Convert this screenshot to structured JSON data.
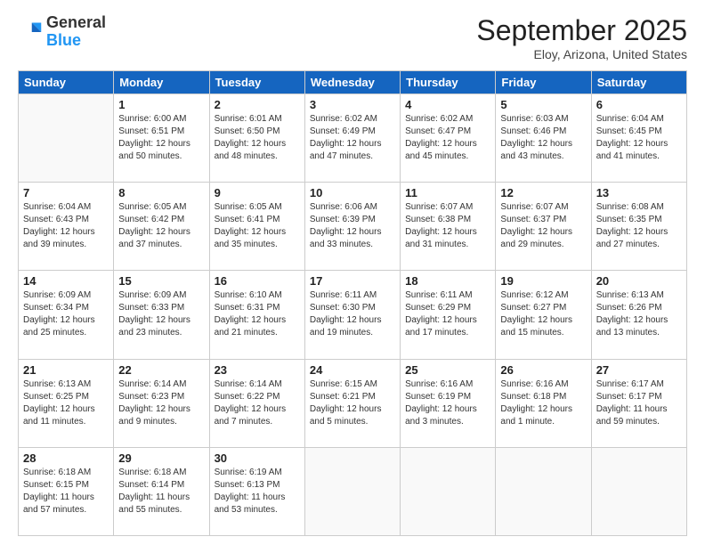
{
  "logo": {
    "general": "General",
    "blue": "Blue"
  },
  "header": {
    "month": "September 2025",
    "location": "Eloy, Arizona, United States"
  },
  "weekdays": [
    "Sunday",
    "Monday",
    "Tuesday",
    "Wednesday",
    "Thursday",
    "Friday",
    "Saturday"
  ],
  "weeks": [
    [
      {
        "day": "",
        "info": ""
      },
      {
        "day": "1",
        "info": "Sunrise: 6:00 AM\nSunset: 6:51 PM\nDaylight: 12 hours\nand 50 minutes."
      },
      {
        "day": "2",
        "info": "Sunrise: 6:01 AM\nSunset: 6:50 PM\nDaylight: 12 hours\nand 48 minutes."
      },
      {
        "day": "3",
        "info": "Sunrise: 6:02 AM\nSunset: 6:49 PM\nDaylight: 12 hours\nand 47 minutes."
      },
      {
        "day": "4",
        "info": "Sunrise: 6:02 AM\nSunset: 6:47 PM\nDaylight: 12 hours\nand 45 minutes."
      },
      {
        "day": "5",
        "info": "Sunrise: 6:03 AM\nSunset: 6:46 PM\nDaylight: 12 hours\nand 43 minutes."
      },
      {
        "day": "6",
        "info": "Sunrise: 6:04 AM\nSunset: 6:45 PM\nDaylight: 12 hours\nand 41 minutes."
      }
    ],
    [
      {
        "day": "7",
        "info": "Sunrise: 6:04 AM\nSunset: 6:43 PM\nDaylight: 12 hours\nand 39 minutes."
      },
      {
        "day": "8",
        "info": "Sunrise: 6:05 AM\nSunset: 6:42 PM\nDaylight: 12 hours\nand 37 minutes."
      },
      {
        "day": "9",
        "info": "Sunrise: 6:05 AM\nSunset: 6:41 PM\nDaylight: 12 hours\nand 35 minutes."
      },
      {
        "day": "10",
        "info": "Sunrise: 6:06 AM\nSunset: 6:39 PM\nDaylight: 12 hours\nand 33 minutes."
      },
      {
        "day": "11",
        "info": "Sunrise: 6:07 AM\nSunset: 6:38 PM\nDaylight: 12 hours\nand 31 minutes."
      },
      {
        "day": "12",
        "info": "Sunrise: 6:07 AM\nSunset: 6:37 PM\nDaylight: 12 hours\nand 29 minutes."
      },
      {
        "day": "13",
        "info": "Sunrise: 6:08 AM\nSunset: 6:35 PM\nDaylight: 12 hours\nand 27 minutes."
      }
    ],
    [
      {
        "day": "14",
        "info": "Sunrise: 6:09 AM\nSunset: 6:34 PM\nDaylight: 12 hours\nand 25 minutes."
      },
      {
        "day": "15",
        "info": "Sunrise: 6:09 AM\nSunset: 6:33 PM\nDaylight: 12 hours\nand 23 minutes."
      },
      {
        "day": "16",
        "info": "Sunrise: 6:10 AM\nSunset: 6:31 PM\nDaylight: 12 hours\nand 21 minutes."
      },
      {
        "day": "17",
        "info": "Sunrise: 6:11 AM\nSunset: 6:30 PM\nDaylight: 12 hours\nand 19 minutes."
      },
      {
        "day": "18",
        "info": "Sunrise: 6:11 AM\nSunset: 6:29 PM\nDaylight: 12 hours\nand 17 minutes."
      },
      {
        "day": "19",
        "info": "Sunrise: 6:12 AM\nSunset: 6:27 PM\nDaylight: 12 hours\nand 15 minutes."
      },
      {
        "day": "20",
        "info": "Sunrise: 6:13 AM\nSunset: 6:26 PM\nDaylight: 12 hours\nand 13 minutes."
      }
    ],
    [
      {
        "day": "21",
        "info": "Sunrise: 6:13 AM\nSunset: 6:25 PM\nDaylight: 12 hours\nand 11 minutes."
      },
      {
        "day": "22",
        "info": "Sunrise: 6:14 AM\nSunset: 6:23 PM\nDaylight: 12 hours\nand 9 minutes."
      },
      {
        "day": "23",
        "info": "Sunrise: 6:14 AM\nSunset: 6:22 PM\nDaylight: 12 hours\nand 7 minutes."
      },
      {
        "day": "24",
        "info": "Sunrise: 6:15 AM\nSunset: 6:21 PM\nDaylight: 12 hours\nand 5 minutes."
      },
      {
        "day": "25",
        "info": "Sunrise: 6:16 AM\nSunset: 6:19 PM\nDaylight: 12 hours\nand 3 minutes."
      },
      {
        "day": "26",
        "info": "Sunrise: 6:16 AM\nSunset: 6:18 PM\nDaylight: 12 hours\nand 1 minute."
      },
      {
        "day": "27",
        "info": "Sunrise: 6:17 AM\nSunset: 6:17 PM\nDaylight: 11 hours\nand 59 minutes."
      }
    ],
    [
      {
        "day": "28",
        "info": "Sunrise: 6:18 AM\nSunset: 6:15 PM\nDaylight: 11 hours\nand 57 minutes."
      },
      {
        "day": "29",
        "info": "Sunrise: 6:18 AM\nSunset: 6:14 PM\nDaylight: 11 hours\nand 55 minutes."
      },
      {
        "day": "30",
        "info": "Sunrise: 6:19 AM\nSunset: 6:13 PM\nDaylight: 11 hours\nand 53 minutes."
      },
      {
        "day": "",
        "info": ""
      },
      {
        "day": "",
        "info": ""
      },
      {
        "day": "",
        "info": ""
      },
      {
        "day": "",
        "info": ""
      }
    ]
  ]
}
